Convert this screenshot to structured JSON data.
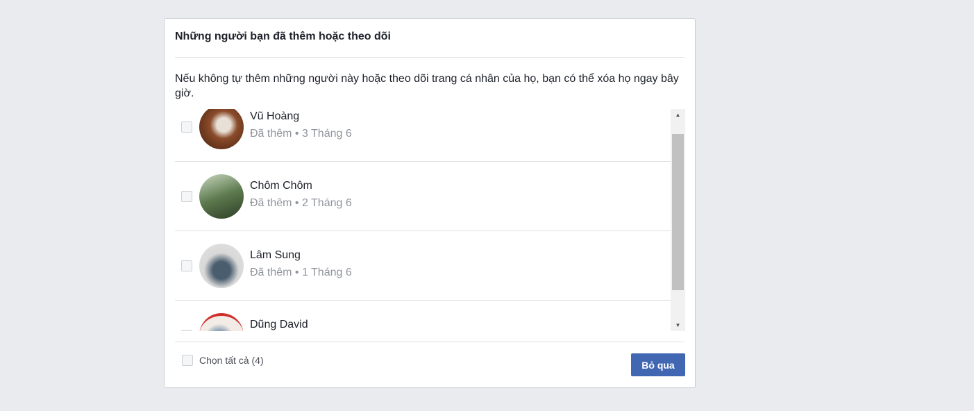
{
  "dialog": {
    "title": "Những người bạn đã thêm hoặc theo dõi",
    "description": "Nếu không tự thêm những người này hoặc theo dõi trang cá nhân của họ, bạn có thể xóa họ ngay bây giờ.",
    "people": [
      {
        "name": "Vũ Hoàng",
        "added": "Đã thêm • 3 Tháng 6"
      },
      {
        "name": "Chôm Chôm",
        "added": "Đã thêm • 2 Tháng 6"
      },
      {
        "name": "Lâm Sung",
        "added": "Đã thêm • 1 Tháng 6"
      },
      {
        "name": "Dũng David",
        "added": ""
      }
    ],
    "select_all": "Chọn tất cả (4)",
    "skip_button": "Bỏ qua"
  },
  "colors": {
    "primary": "#4267b2",
    "background": "#e9ebee"
  }
}
